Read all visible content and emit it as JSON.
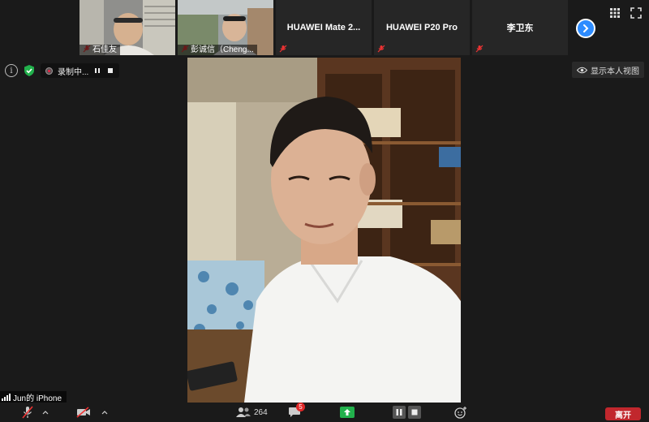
{
  "participants_strip": [
    {
      "name": "石佳友",
      "has_video": true,
      "muted": true
    },
    {
      "name": "彭诚信（Cheng...",
      "has_video": true,
      "muted": true
    },
    {
      "name": "HUAWEI Mate 2...",
      "has_video": false,
      "muted": true
    },
    {
      "name": "HUAWEI P20 Pro",
      "has_video": false,
      "muted": true
    },
    {
      "name": "李卫东",
      "has_video": false,
      "muted": true
    }
  ],
  "recording": {
    "label": "录制中..."
  },
  "show_self_view": {
    "label": "显示本人视图"
  },
  "active_speaker": {
    "name": "Jun的 iPhone"
  },
  "toolbar": {
    "participants_count": "264",
    "chat_badge": "5",
    "leave_label": "离开"
  },
  "colors": {
    "accent": "#2d8cff",
    "leave": "#c1272d",
    "badge": "#e02828",
    "share_green": "#22b14c"
  }
}
